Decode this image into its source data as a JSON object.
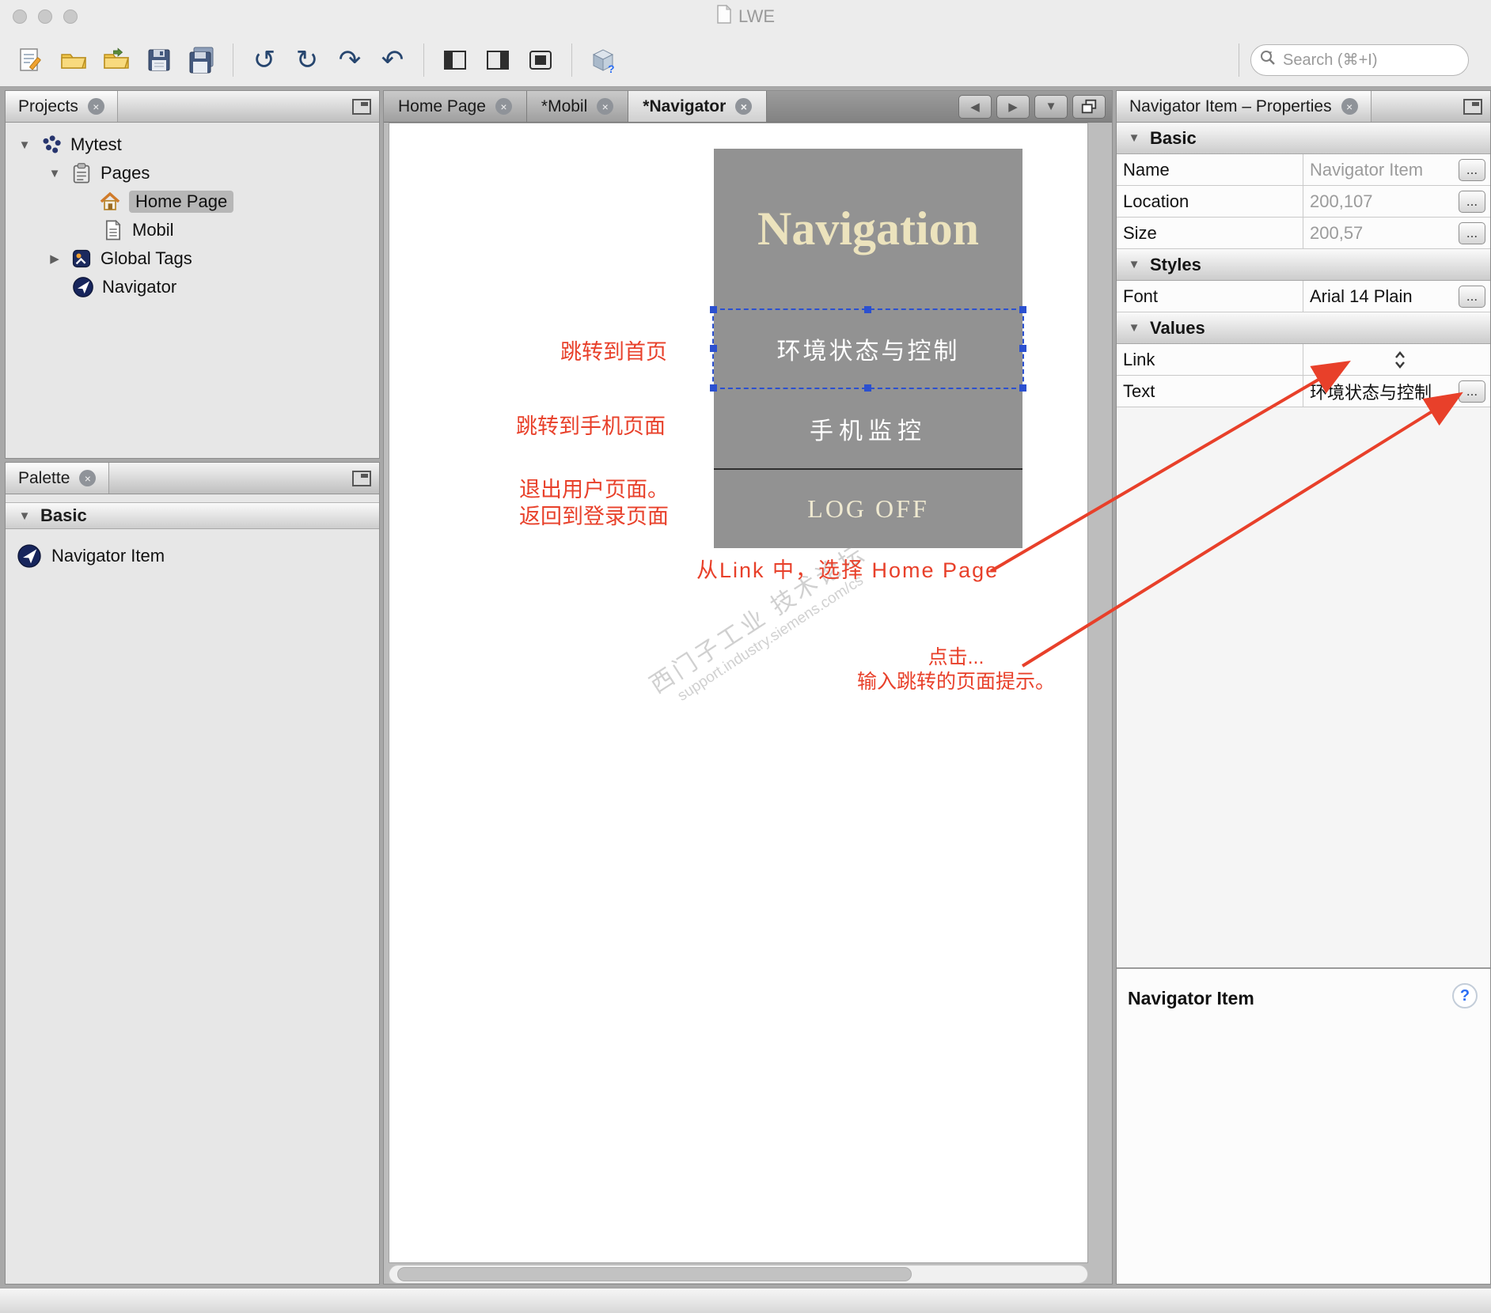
{
  "window": {
    "title": "LWE"
  },
  "toolbar": {
    "search_placeholder": "Search (⌘+I)"
  },
  "icons": {
    "close": "×",
    "disclosure_open": "▼",
    "disclosure_closed": "▶",
    "undo": "↺",
    "redo": "↻",
    "jump_forward": "↷",
    "jump_back": "↶",
    "prev": "◀",
    "next": "▶",
    "dropdown": "▼",
    "ellipsis": "...",
    "help": "?"
  },
  "projects": {
    "title": "Projects",
    "items": [
      {
        "label": "Mytest"
      },
      {
        "label": "Pages"
      },
      {
        "label": "Home Page"
      },
      {
        "label": "Mobil"
      },
      {
        "label": "Global Tags"
      },
      {
        "label": "Navigator"
      }
    ]
  },
  "palette": {
    "title": "Palette",
    "section": "Basic",
    "item": "Navigator Item"
  },
  "editor": {
    "tabs": [
      {
        "label": "Home Page"
      },
      {
        "label": "*Mobil"
      },
      {
        "label": "*Navigator"
      }
    ],
    "widget": {
      "title": "Navigation",
      "items": [
        "环境状态与控制",
        "手机监控",
        "LOG OFF"
      ]
    },
    "annotations": {
      "home": "跳转到首页",
      "mobile": "跳转到手机页面",
      "logoff1": "退出用户页面。",
      "logoff2": "返回到登录页面",
      "link": "从Link 中，选择 Home Page",
      "click1": "点击...",
      "click2": "输入跳转的页面提示。"
    },
    "watermark": {
      "line1": "西门子工业 技术论坛",
      "line2": "support.industry.siemens.com/cs"
    }
  },
  "properties": {
    "title": "Navigator Item – Properties",
    "sections": {
      "basic": "Basic",
      "styles": "Styles",
      "values": "Values"
    },
    "name_label": "Name",
    "name_value": "Navigator Item",
    "location_label": "Location",
    "location_value": "200,107",
    "size_label": "Size",
    "size_value": "200,57",
    "font_label": "Font",
    "font_value": "Arial 14 Plain",
    "link_label": "Link",
    "link_value": "",
    "text_label": "Text",
    "text_value": "环境状态与控制"
  },
  "help": {
    "title": "Navigator Item"
  },
  "colors": {
    "annotation_red": "#e8402a",
    "selection_blue": "#2b50d0",
    "widget_gray": "#929292",
    "widget_cream": "#ece3bd"
  }
}
